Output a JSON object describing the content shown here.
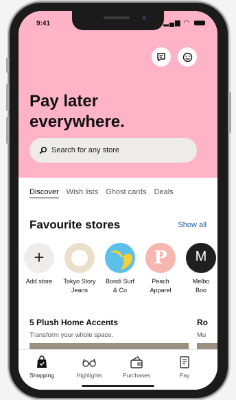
{
  "status_bar": {
    "time": "9:41"
  },
  "hero": {
    "headline_line1": "Pay later",
    "headline_line2": "everywhere."
  },
  "search": {
    "placeholder": "Search for any store"
  },
  "tabs": [
    {
      "label": "Discover",
      "active": true
    },
    {
      "label": "Wish lists",
      "active": false
    },
    {
      "label": "Ghost cards",
      "active": false
    },
    {
      "label": "Deals",
      "active": false
    }
  ],
  "favourites": {
    "title": "Favourite stores",
    "show_all": "Show all",
    "stores": [
      {
        "label1": "Add store",
        "label2": "",
        "letter": "+"
      },
      {
        "label1": "Tokyo Story",
        "label2": "Jeans",
        "letter": ""
      },
      {
        "label1": "Bondi Surf",
        "label2": "& Co",
        "letter": ""
      },
      {
        "label1": "Peach",
        "label2": "Apparel",
        "letter": "P"
      },
      {
        "label1": "Melbo",
        "label2": "Boo",
        "letter": "M"
      }
    ]
  },
  "promos": [
    {
      "title": "5 Plush Home Accents",
      "subtitle": "Transform your whole space."
    },
    {
      "title": "Ro",
      "subtitle": "Mu"
    }
  ],
  "nav": [
    {
      "label": "Shopping",
      "icon": "shopping-bag-icon",
      "active": true
    },
    {
      "label": "Highlights",
      "icon": "glasses-icon",
      "active": false
    },
    {
      "label": "Purchases",
      "icon": "wallet-icon",
      "active": false
    },
    {
      "label": "Pay",
      "icon": "receipt-icon",
      "active": false
    }
  ],
  "colors": {
    "hero_bg": "#ffb3c7",
    "link": "#1a5ea8",
    "search_bg": "#eeece8"
  }
}
